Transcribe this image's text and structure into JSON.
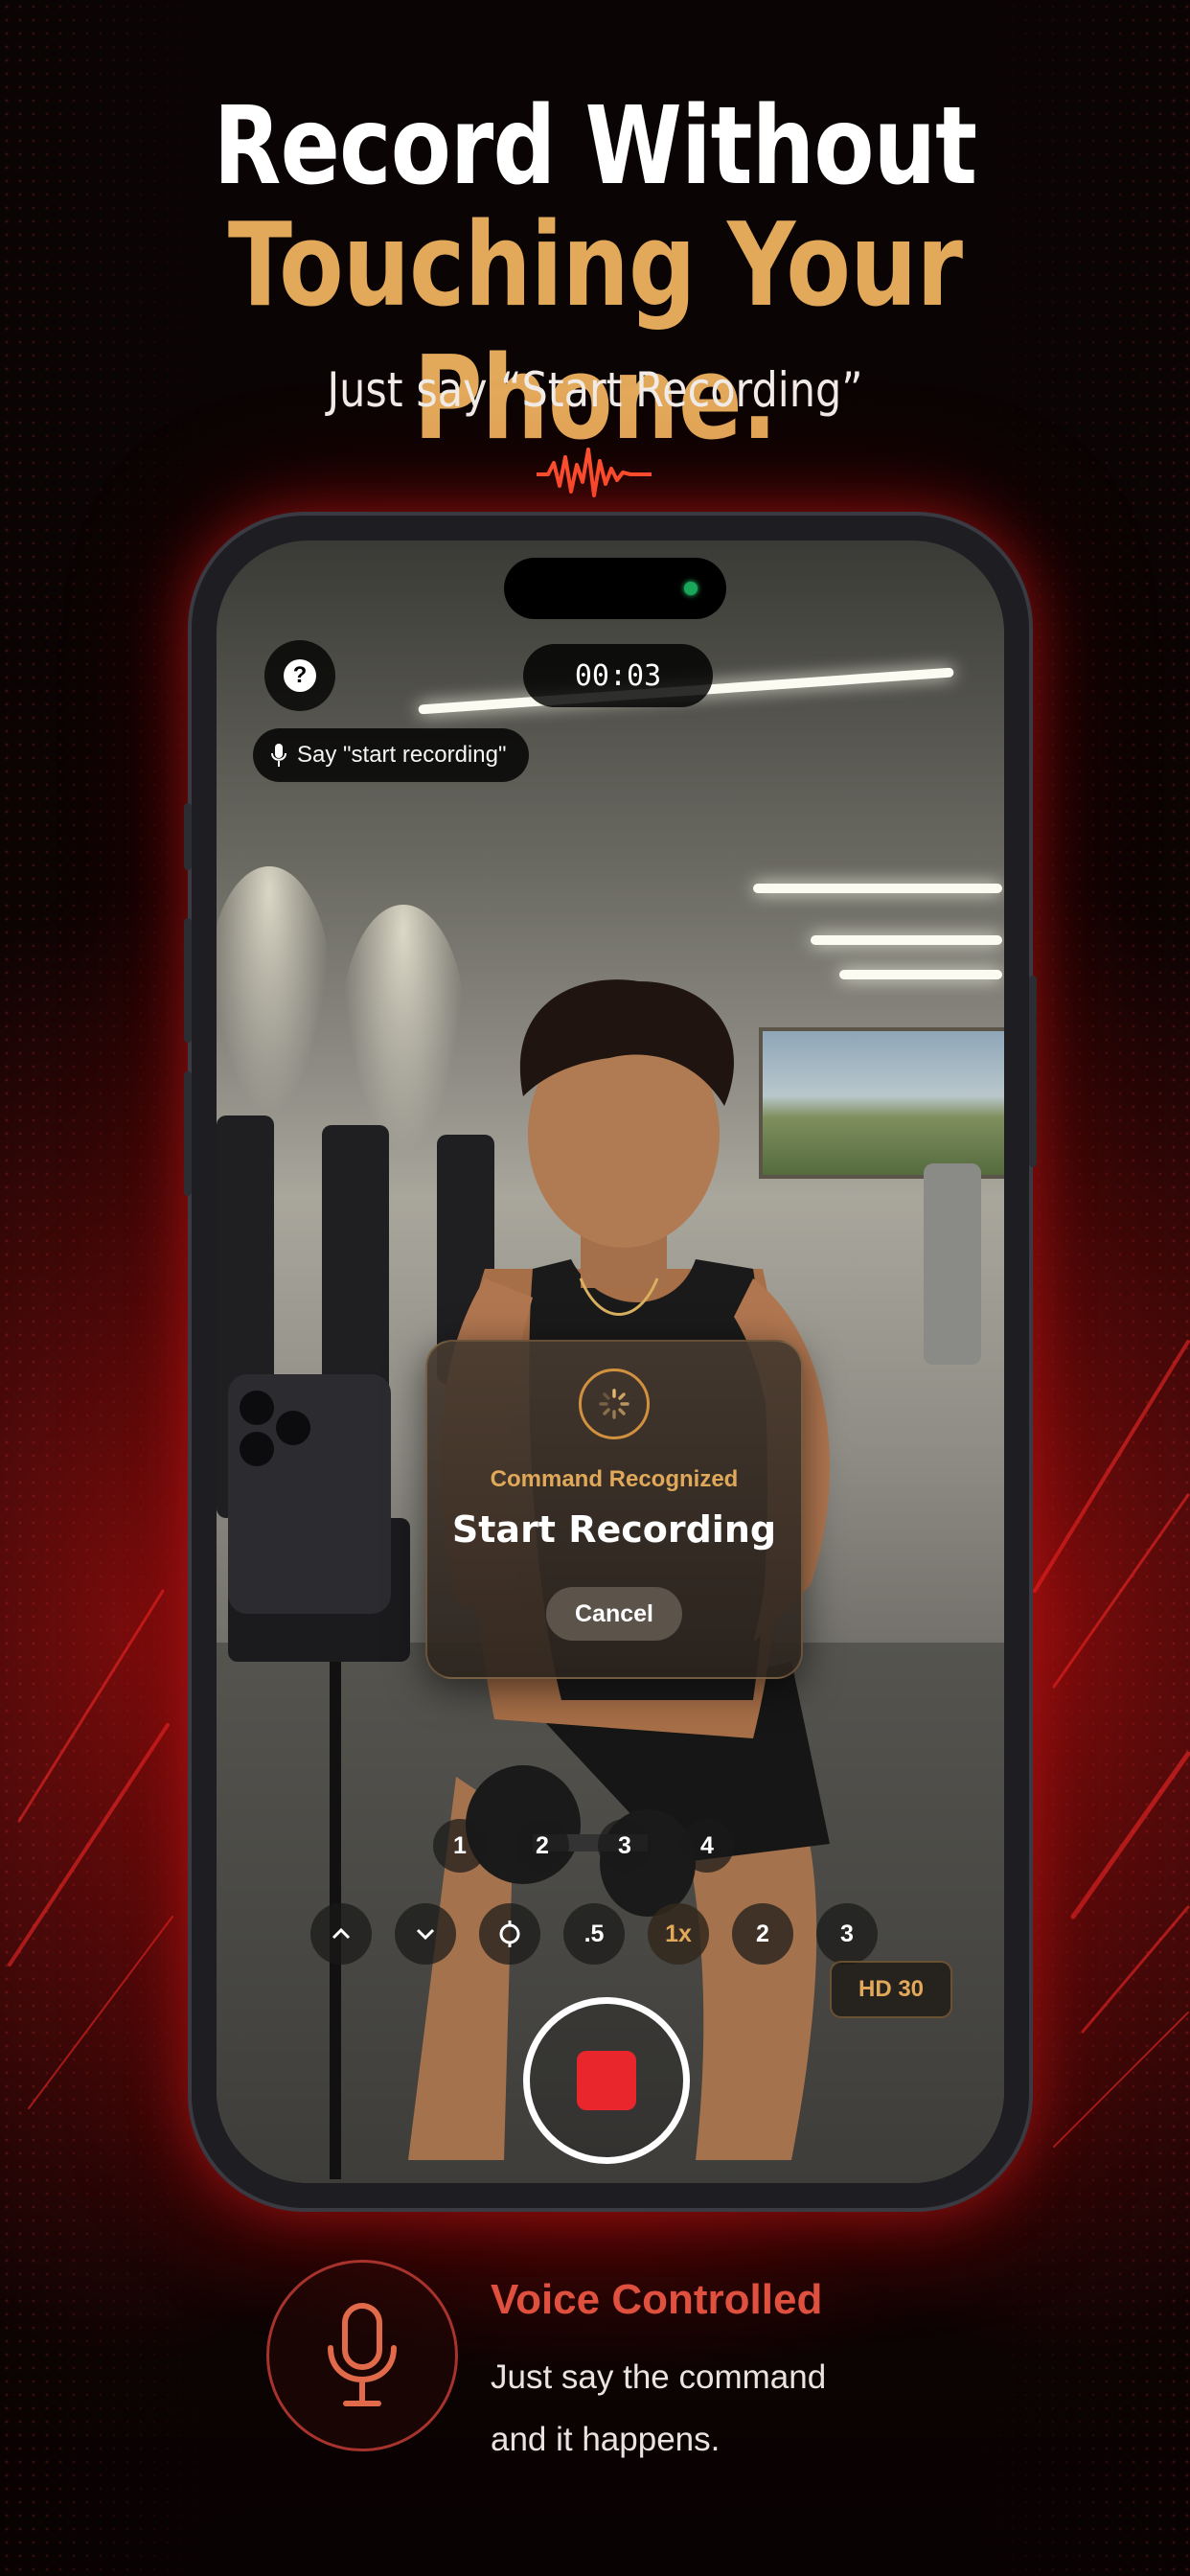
{
  "headline": {
    "line1": "Record Without",
    "line2": "Touching Your Phone.",
    "subtitle": "Just say “Start Recording”"
  },
  "colors": {
    "accent_gold": "#e3a95a",
    "accent_red": "#e0503e",
    "record_red": "#e8262b",
    "background": "#070303"
  },
  "camera": {
    "timer": "00:03",
    "help_icon": "?",
    "voice_hint": "Say \"start recording\"",
    "quality_badge": "HD 30"
  },
  "command_modal": {
    "caption": "Command Recognized",
    "title": "Start Recording",
    "cancel_label": "Cancel"
  },
  "speed_row": [
    "1",
    "2",
    "3",
    "4"
  ],
  "zoom_row": {
    "up_icon": "chevron-up-icon",
    "down_icon": "chevron-down-icon",
    "focus_icon": "focus-icon",
    "levels": [
      ".5",
      "1x",
      "2",
      "3"
    ],
    "selected": "1x"
  },
  "feature": {
    "icon": "microphone-icon",
    "title": "Voice Controlled",
    "line1": "Just say the command",
    "line2": "and it happens."
  }
}
